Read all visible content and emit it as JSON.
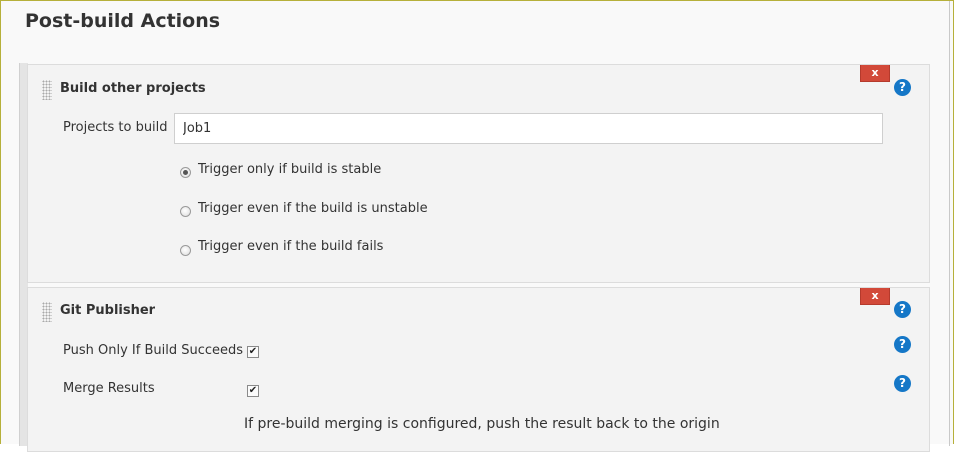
{
  "page": {
    "title": "Post-build Actions"
  },
  "build_other_projects": {
    "title": "Build other projects",
    "delete_label": "x",
    "help_label": "?",
    "projects_label": "Projects to build",
    "projects_value": "Job1",
    "trigger_options": [
      {
        "label": "Trigger only if build is stable",
        "checked": true
      },
      {
        "label": "Trigger even if the build is unstable",
        "checked": false
      },
      {
        "label": "Trigger even if the build fails",
        "checked": false
      }
    ]
  },
  "git_publisher": {
    "title": "Git Publisher",
    "delete_label": "x",
    "help_label": "?",
    "push_only_label": "Push Only If Build Succeeds",
    "push_only_checked": true,
    "merge_results_label": "Merge Results",
    "merge_results_checked": true,
    "merge_note": "If pre-build merging is configured, push the result back to the origin"
  },
  "colors": {
    "delete_button": "#d24939",
    "help_icon": "#1577c7",
    "frame_border": "#b6b03a"
  },
  "icons": {
    "drag": "drag-handle-icon",
    "help": "help-icon",
    "delete": "delete-icon"
  }
}
